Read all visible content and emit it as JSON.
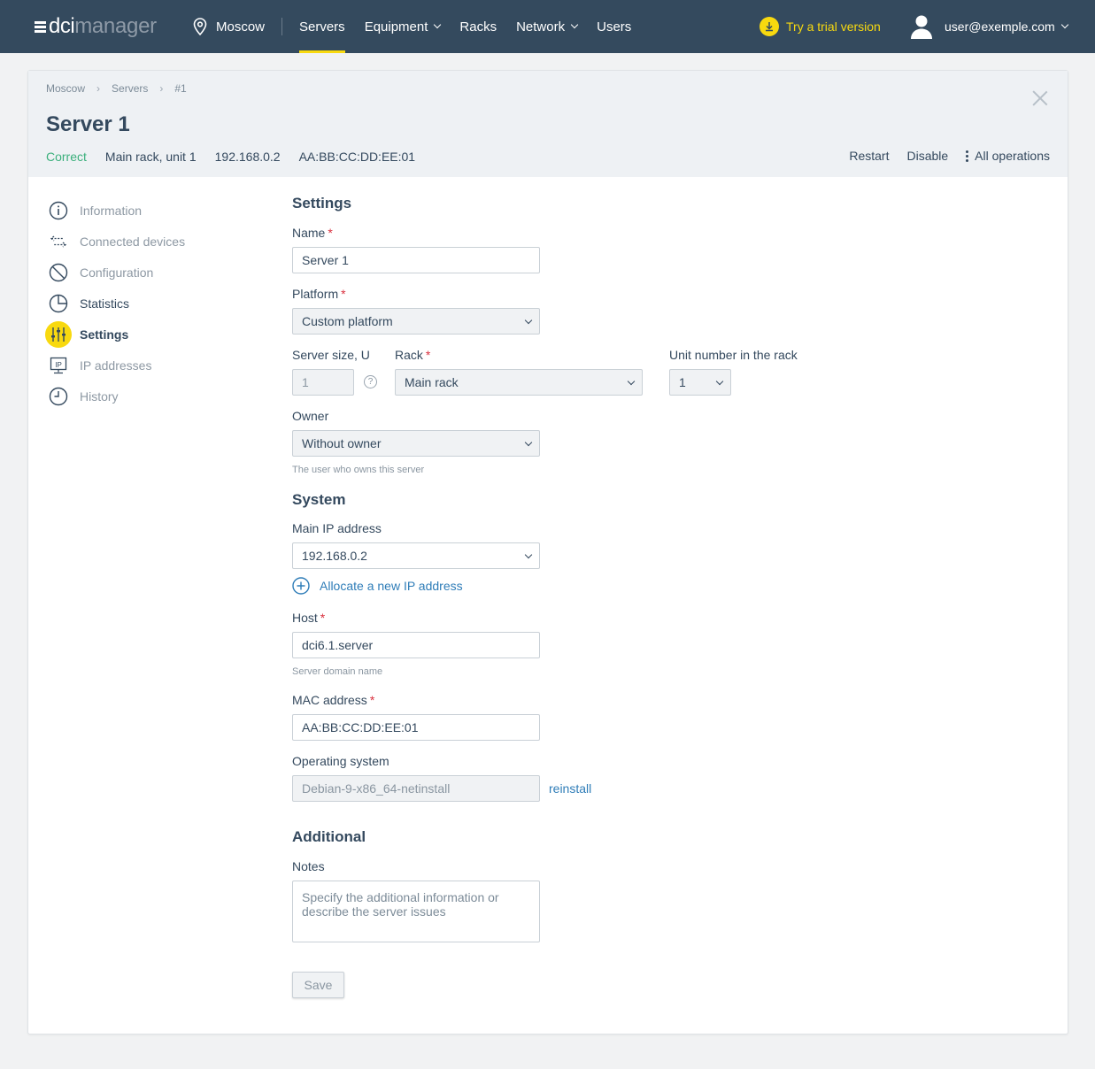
{
  "header": {
    "logo_primary": "dci",
    "logo_secondary": "manager",
    "location": "Moscow",
    "nav": [
      {
        "label": "Servers",
        "active": true
      },
      {
        "label": "Equipment",
        "dropdown": true
      },
      {
        "label": "Racks"
      },
      {
        "label": "Network",
        "dropdown": true
      },
      {
        "label": "Users"
      }
    ],
    "trial_label": "Try a trial version",
    "user_email": "user@exemple.com",
    "accent_color": "#f8d90f",
    "bar_color": "#344a5e"
  },
  "breadcrumb": [
    "Moscow",
    "Servers",
    "#1"
  ],
  "server": {
    "title": "Server 1",
    "status": "Correct",
    "location": "Main rack, unit 1",
    "ip": "192.168.0.2",
    "mac": "AA:BB:CC:DD:EE:01",
    "status_color": "#3bb07c"
  },
  "actions": {
    "restart": "Restart",
    "disable": "Disable",
    "all_operations": "All operations"
  },
  "sidebar": {
    "items": [
      {
        "label": "Information",
        "icon": "info-icon"
      },
      {
        "label": "Connected devices",
        "icon": "connected-devices-icon"
      },
      {
        "label": "Configuration",
        "icon": "configuration-icon"
      },
      {
        "label": "Statistics",
        "icon": "statistics-icon"
      },
      {
        "label": "Settings",
        "icon": "settings-icon",
        "active": true
      },
      {
        "label": "IP addresses",
        "icon": "ip-icon"
      },
      {
        "label": "History",
        "icon": "history-icon"
      }
    ]
  },
  "form": {
    "settings_heading": "Settings",
    "name_label": "Name",
    "name_value": "Server 1",
    "platform_label": "Platform",
    "platform_value": "Custom platform",
    "size_label": "Server size, U",
    "size_value": "1",
    "help_glyph": "?",
    "rack_label": "Rack",
    "rack_value": "Main rack",
    "unit_label": "Unit number in the rack",
    "unit_value": "1",
    "owner_label": "Owner",
    "owner_value": "Without owner",
    "owner_hint": "The user who owns this server",
    "system_heading": "System",
    "main_ip_label": "Main IP address",
    "main_ip_value": "192.168.0.2",
    "allocate_ip": "Allocate a new IP address",
    "host_label": "Host",
    "host_value": "dci6.1.server",
    "host_hint": "Server domain name",
    "mac_label": "MAC address",
    "mac_value": "AA:BB:CC:DD:EE:01",
    "os_label": "Operating system",
    "os_value": "Debian-9-x86_64-netinstall",
    "reinstall": "reinstall",
    "additional_heading": "Additional",
    "notes_label": "Notes",
    "notes_placeholder": "Specify the additional information or describe the server issues",
    "save": "Save",
    "required_mark": "*"
  }
}
